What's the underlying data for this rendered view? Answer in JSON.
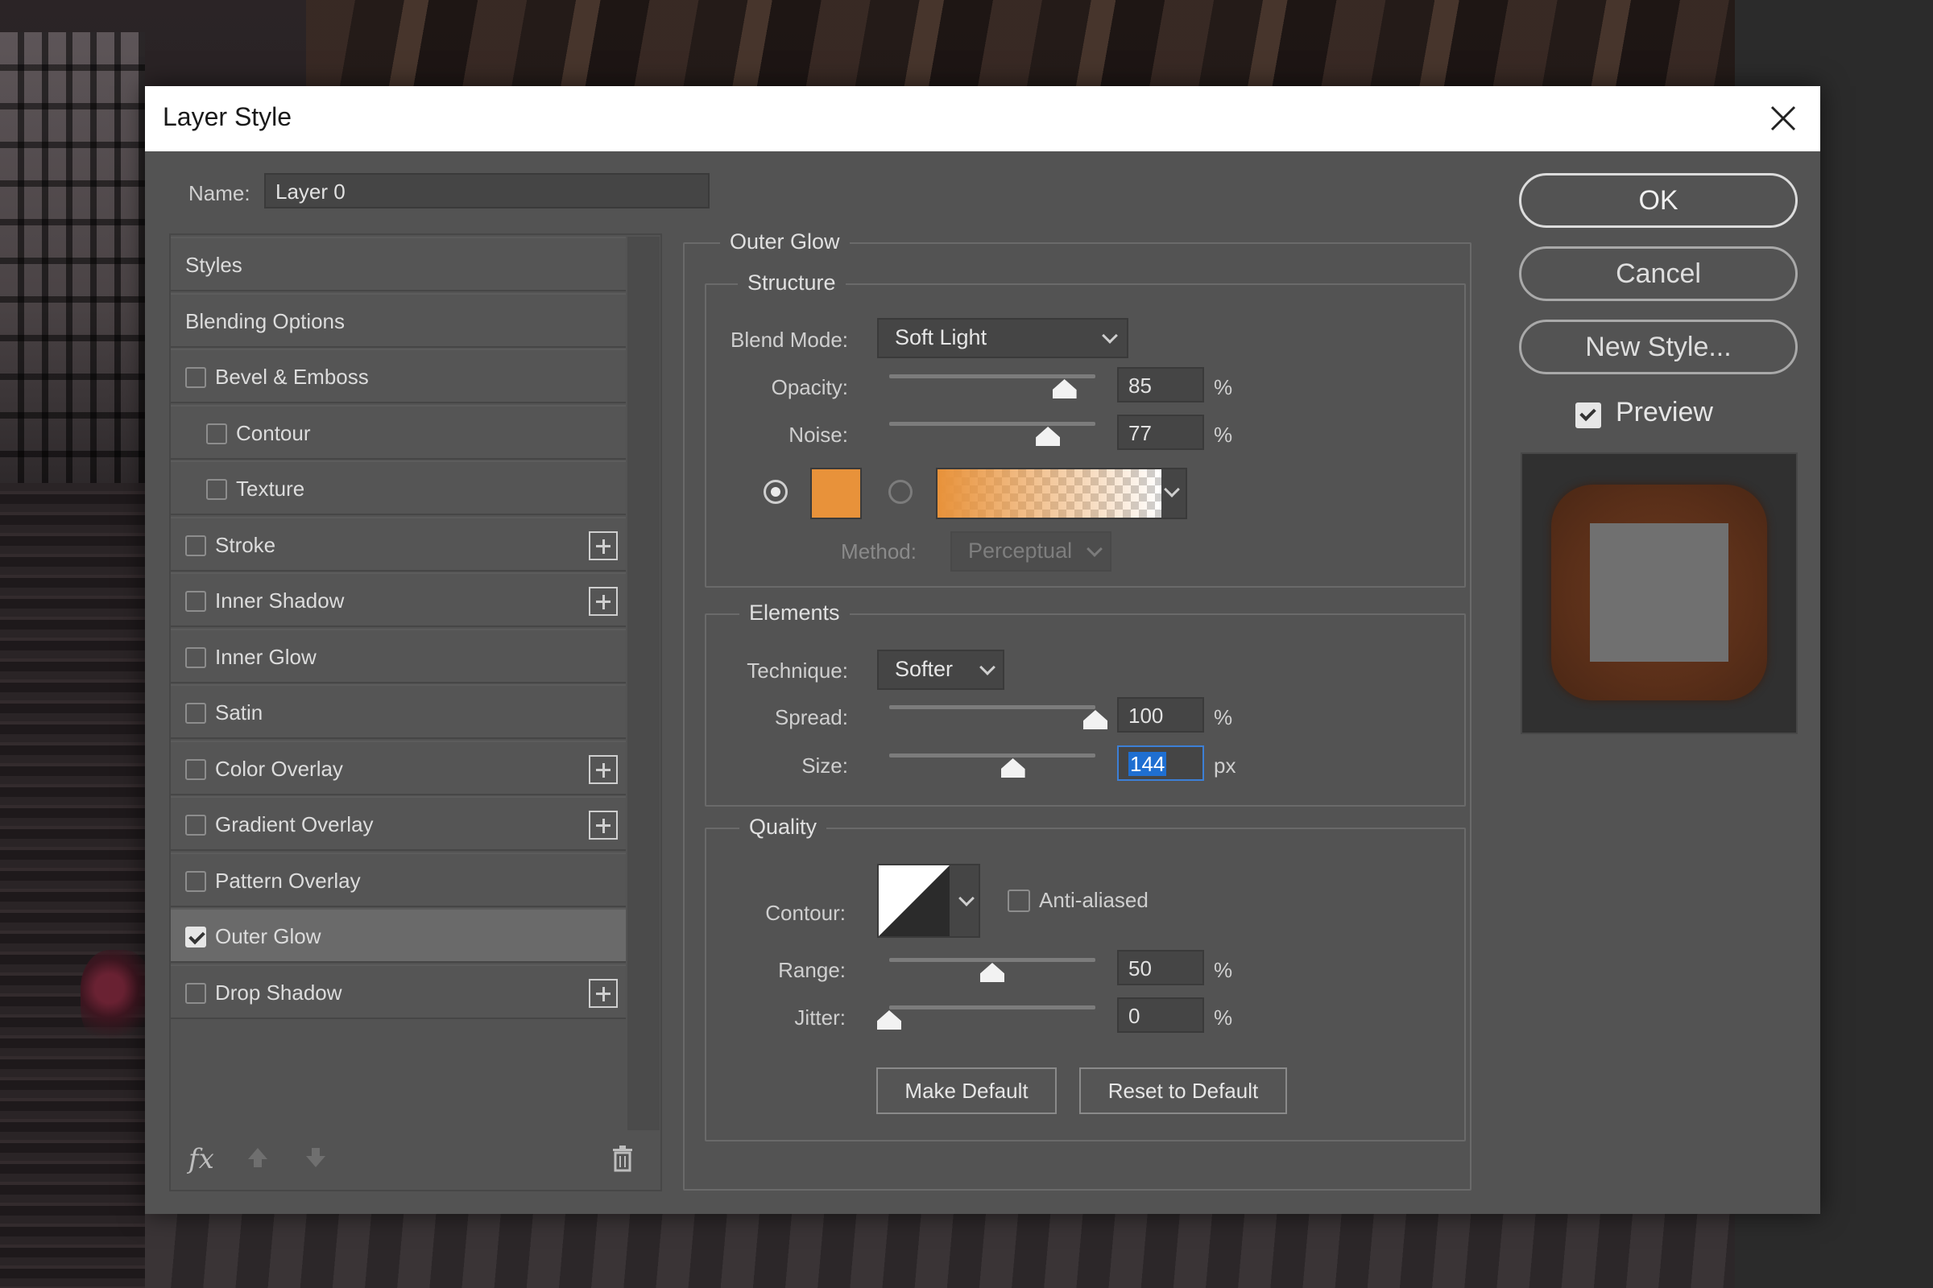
{
  "dialog": {
    "title": "Layer Style"
  },
  "name_field": {
    "label": "Name:",
    "value": "Layer 0"
  },
  "styles_list": [
    {
      "label": "Styles",
      "checkbox": false,
      "checked": false,
      "plus": false,
      "selected": false,
      "indent": 0
    },
    {
      "label": "Blending Options",
      "checkbox": false,
      "checked": false,
      "plus": false,
      "selected": false,
      "indent": 0
    },
    {
      "label": "Bevel & Emboss",
      "checkbox": true,
      "checked": false,
      "plus": false,
      "selected": false,
      "indent": 0
    },
    {
      "label": "Contour",
      "checkbox": true,
      "checked": false,
      "plus": false,
      "selected": false,
      "indent": 1
    },
    {
      "label": "Texture",
      "checkbox": true,
      "checked": false,
      "plus": false,
      "selected": false,
      "indent": 1
    },
    {
      "label": "Stroke",
      "checkbox": true,
      "checked": false,
      "plus": true,
      "selected": false,
      "indent": 0
    },
    {
      "label": "Inner Shadow",
      "checkbox": true,
      "checked": false,
      "plus": true,
      "selected": false,
      "indent": 0
    },
    {
      "label": "Inner Glow",
      "checkbox": true,
      "checked": false,
      "plus": false,
      "selected": false,
      "indent": 0
    },
    {
      "label": "Satin",
      "checkbox": true,
      "checked": false,
      "plus": false,
      "selected": false,
      "indent": 0
    },
    {
      "label": "Color Overlay",
      "checkbox": true,
      "checked": false,
      "plus": true,
      "selected": false,
      "indent": 0
    },
    {
      "label": "Gradient Overlay",
      "checkbox": true,
      "checked": false,
      "plus": true,
      "selected": false,
      "indent": 0
    },
    {
      "label": "Pattern Overlay",
      "checkbox": true,
      "checked": false,
      "plus": false,
      "selected": false,
      "indent": 0
    },
    {
      "label": "Outer Glow",
      "checkbox": true,
      "checked": true,
      "plus": false,
      "selected": true,
      "indent": 0
    },
    {
      "label": "Drop Shadow",
      "checkbox": true,
      "checked": false,
      "plus": true,
      "selected": false,
      "indent": 0
    }
  ],
  "styles_toolbar": {
    "fx_label": "fx"
  },
  "outer_glow": {
    "title": "Outer Glow",
    "structure": {
      "title": "Structure",
      "blend_mode_label": "Blend Mode:",
      "blend_mode_value": "Soft Light",
      "opacity_label": "Opacity:",
      "opacity_value": "85",
      "opacity_unit": "%",
      "opacity_level": 0.85,
      "noise_label": "Noise:",
      "noise_value": "77",
      "noise_unit": "%",
      "noise_level": 0.77,
      "glow_color": "#e8923a",
      "method_label": "Method:",
      "method_value": "Perceptual"
    },
    "elements": {
      "title": "Elements",
      "technique_label": "Technique:",
      "technique_value": "Softer",
      "spread_label": "Spread:",
      "spread_value": "100",
      "spread_unit": "%",
      "spread_level": 1.0,
      "size_label": "Size:",
      "size_value": "144",
      "size_unit": "px",
      "size_level": 0.6
    },
    "quality": {
      "title": "Quality",
      "contour_label": "Contour:",
      "anti_aliased_label": "Anti-aliased",
      "range_label": "Range:",
      "range_value": "50",
      "range_unit": "%",
      "range_level": 0.5,
      "jitter_label": "Jitter:",
      "jitter_value": "0",
      "jitter_unit": "%",
      "jitter_level": 0.0
    },
    "make_default_label": "Make Default",
    "reset_default_label": "Reset to Default"
  },
  "actions": {
    "ok_label": "OK",
    "cancel_label": "Cancel",
    "new_style_label": "New Style...",
    "preview_label": "Preview"
  },
  "colors": {
    "dialog_bg": "#535353",
    "glow_orange": "#e8923a",
    "selection_blue": "#1f6fd1"
  }
}
